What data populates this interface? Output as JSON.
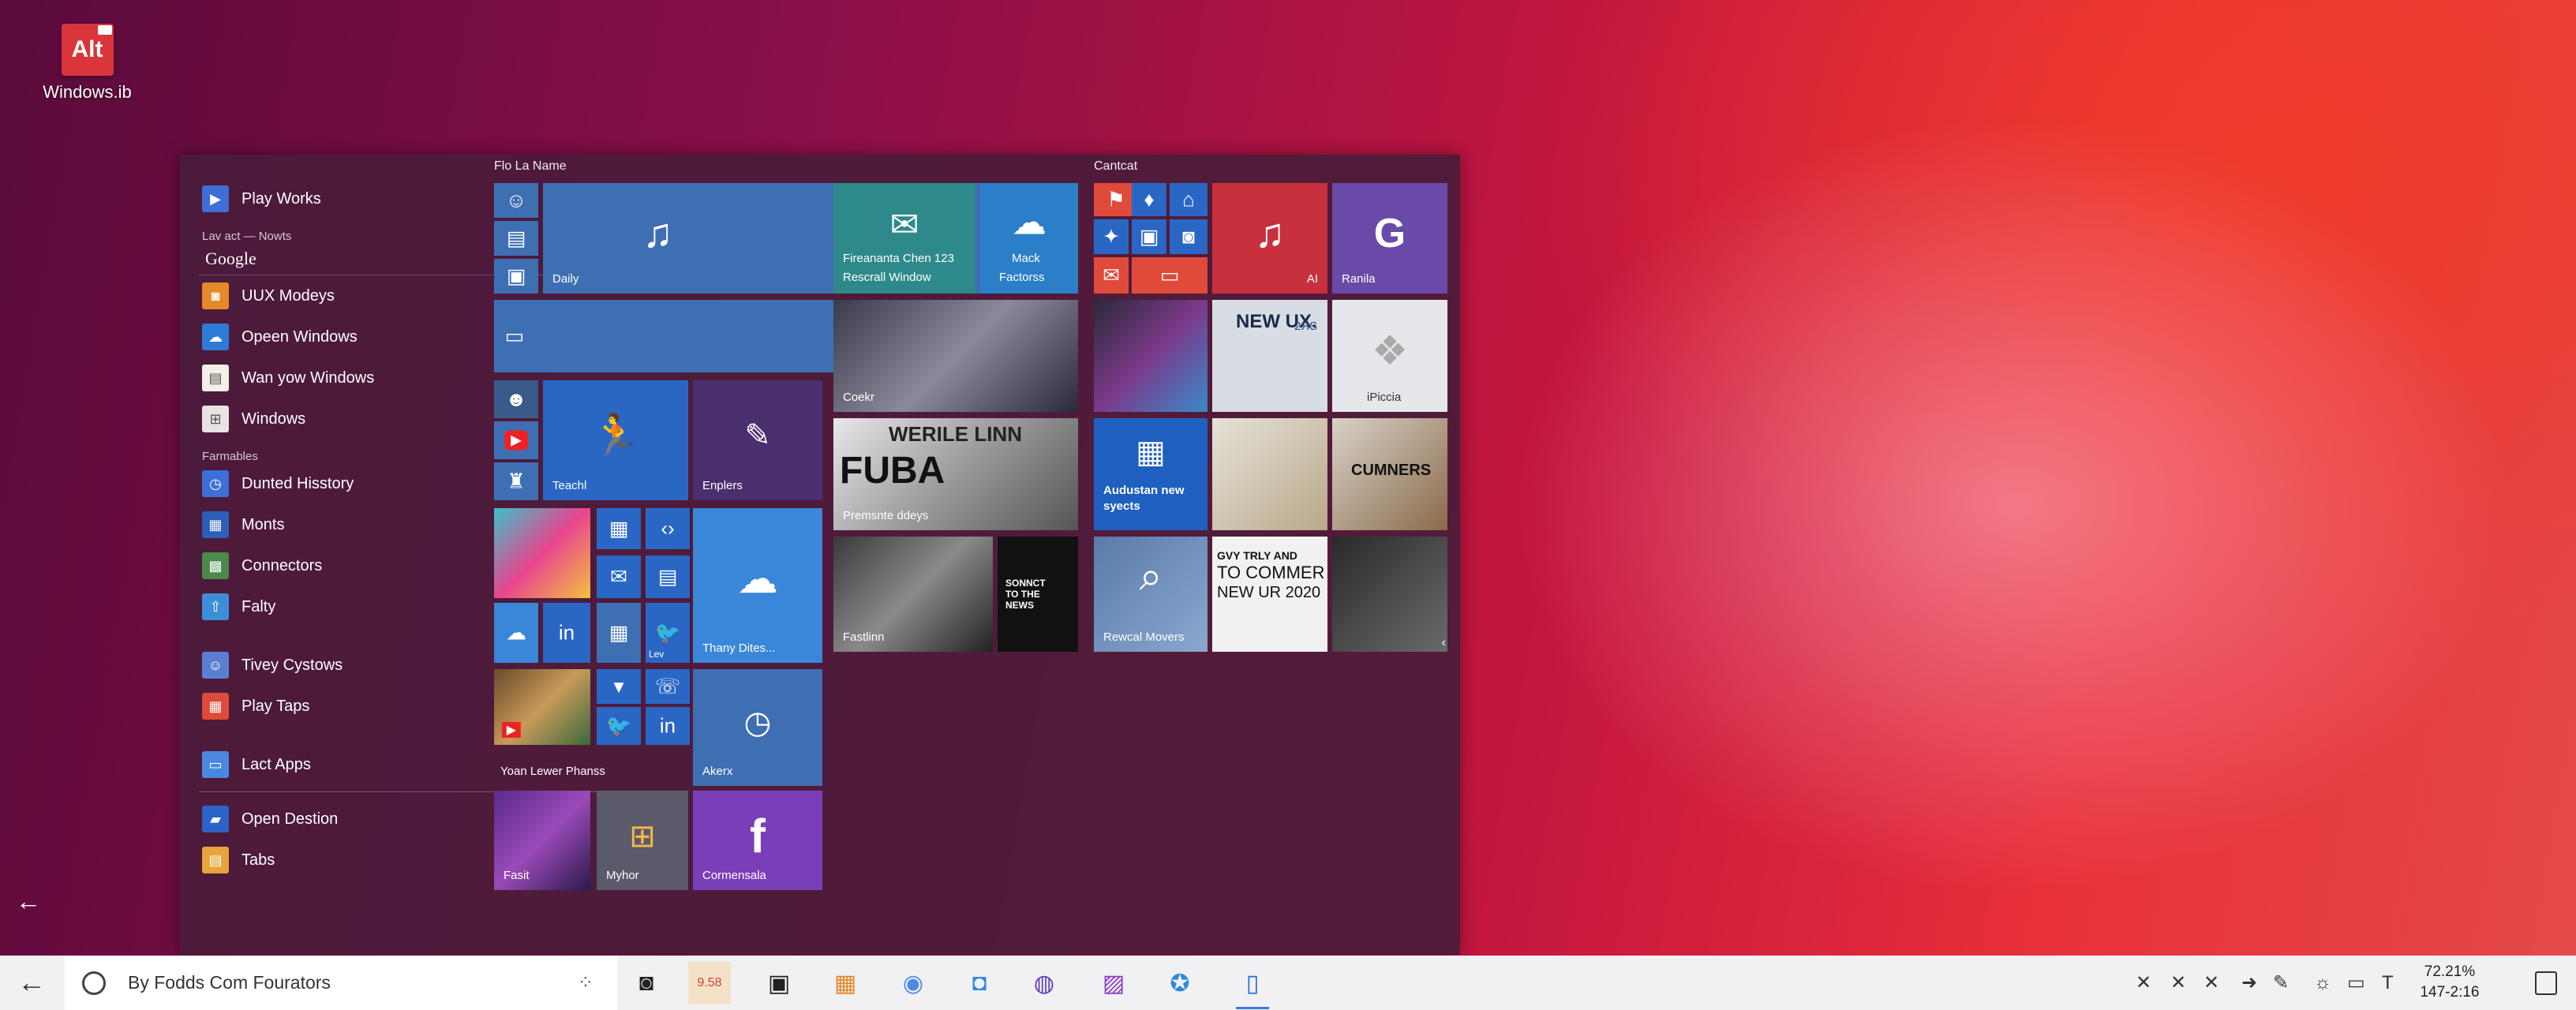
{
  "desktop": {
    "icon_label": "Windows.ib",
    "icon_badge": "Alt"
  },
  "start_menu": {
    "apps": [
      {
        "label": "Play Works",
        "icon": "play-icon",
        "color": "#3d6fd6"
      },
      {
        "section": "Lav act — Nowts"
      },
      {
        "google": "Google"
      },
      {
        "label": "UUX Modeys",
        "icon": "camera-icon",
        "color": "#e58a2a"
      },
      {
        "label": "Opeen Windows",
        "icon": "cloud-icon",
        "color": "#2f7ad6"
      },
      {
        "label": "Wan yow Windows",
        "icon": "doc-icon",
        "color": "#f2efe7"
      },
      {
        "label": "Windows",
        "icon": "windows-icon",
        "color": "#e8e3e3"
      },
      {
        "section": "Farmables"
      },
      {
        "label": "Dunted Hisstory",
        "icon": "history-icon",
        "color": "#3d6fd6",
        "chevron": true
      },
      {
        "label": "Monts",
        "icon": "grid-icon",
        "color": "#2d5fb8"
      },
      {
        "label": "Connectors",
        "icon": "blocks-icon",
        "color": "#4a8a4a"
      },
      {
        "label": "Falty",
        "icon": "upload-icon",
        "color": "#3d8ed6",
        "chevron": true
      },
      {
        "spacer": true
      },
      {
        "label": "Tivey Cystows",
        "icon": "user-icon",
        "color": "#5a7fd0"
      },
      {
        "label": "Play Taps",
        "icon": "tiles-icon",
        "color": "#e04a3a"
      },
      {
        "spacer": true
      },
      {
        "label": "Lact Apps",
        "icon": "laptop-icon",
        "color": "#4a87e0"
      },
      {
        "divider": true
      },
      {
        "label": "Open Destion",
        "icon": "folder-icon",
        "color": "#2d63c8"
      },
      {
        "label": "Tabs",
        "icon": "tabs-icon",
        "color": "#e6a43a",
        "chevron": true
      }
    ],
    "group1_title": "Flo La Name",
    "group2_title": "Cantcat",
    "tiles": {
      "daily": "Daily",
      "teachl": "Teachl",
      "enplers": "Enplers",
      "thany": "Thany Dites...",
      "akerx": "Akerx",
      "yoan": "Yoan Lewer Phanss",
      "fasit": "Fasit",
      "myhor": "Myhor",
      "cormensala": "Cormensala",
      "mail_line1": "Fireananta Chen 123",
      "mail_line2": "Rescrall Window",
      "mack_line1": "Mack",
      "mack_line2": "Factorss",
      "ai": "AI",
      "ranila": "Ranila",
      "coekr": "Coekr",
      "fuba_head": "WERILE LINN",
      "fuba_big": "FUBA",
      "fuba_sub": "Premsnte ddeys",
      "fastlin": "Fastlinn",
      "soncat": "SONNCT TO THE NEWS",
      "audustan_line1": "Audustan new",
      "audustan_line2": "syects",
      "rewcal": "Rewcal Movers",
      "newux_big": "NEW UX.",
      "newux_year": "2ЯS",
      "ipicia": "iPiccia",
      "cumners": "CUMNERS",
      "gvy_line1": "GVY TRLY AND",
      "gvy_line2": "TO COMMER",
      "gvy_line3": "NEW UR 2020"
    }
  },
  "taskbar": {
    "search_text": "By Fodds Com Fourators",
    "badge": "9.58",
    "clock_line1": "72.21%",
    "clock_line2": "147-2:16"
  }
}
